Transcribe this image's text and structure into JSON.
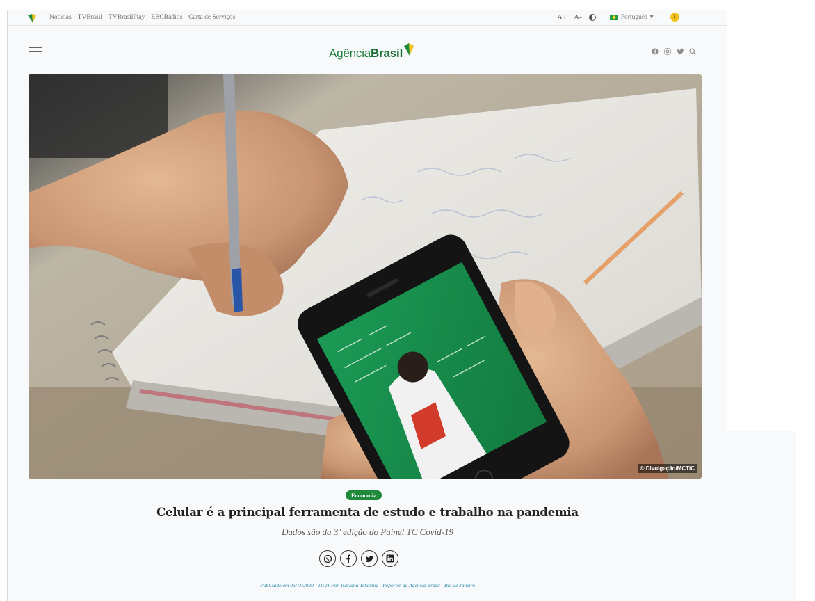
{
  "topbar": {
    "links": [
      "Notícias",
      "TVBrasil",
      "TVBrasilPlay",
      "EBCRádios",
      "Carta de Serviços"
    ],
    "font_increase": "A+",
    "font_decrease": "A-",
    "language": "Português"
  },
  "header": {
    "brand_light": "Agência",
    "brand_bold": "Brasil"
  },
  "hero": {
    "credit": "© Divulgação/MCTIC"
  },
  "article": {
    "category": "Economia",
    "title": "Celular é a principal ferramenta de estudo e trabalho na pandemia",
    "subtitle": "Dados são da 3ª edição do Painel TC Covid-19",
    "byline": "Publicado em 05/11/2020 - 11:21 Por Mariana Tokarnia - Repórter da Agência Brasil - Rio de Janeiro"
  },
  "share": [
    "whatsapp-icon",
    "facebook-icon",
    "twitter-icon",
    "linkedin-icon"
  ],
  "colors": {
    "brand_green": "#1b7e3a",
    "brand_yellow": "#f3c220",
    "badge_green": "#1f8a3c",
    "byline_blue": "#2b8cae"
  }
}
